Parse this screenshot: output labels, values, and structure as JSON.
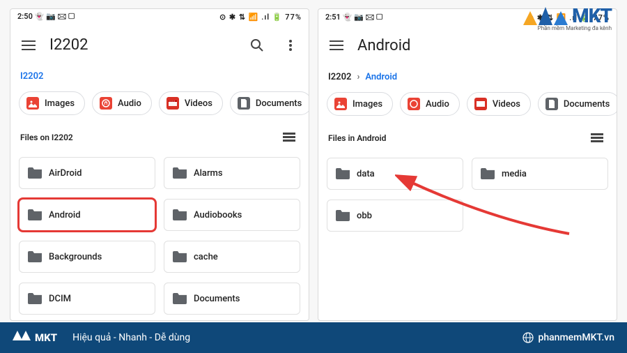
{
  "left": {
    "status_time": "2:50",
    "status_left_icons": "👻 📷 🖂 ▢",
    "status_right": "⊙ ✱ ⇅ 📶 .ıl 🔋 77%",
    "title": "I2202",
    "breadcrumb_root": "I2202",
    "section_label": "Files on I2202",
    "folders": [
      "AirDroid",
      "Alarms",
      "Android",
      "Audiobooks",
      "Backgrounds",
      "cache",
      "DCIM",
      "Documents"
    ]
  },
  "right": {
    "status_time": "2:51",
    "status_left_icons": "👻 📷 🖂 ▢",
    "status_right": "⊙ ✱ ⇅ 📶 .ıl 🔋 77%",
    "title": "Android",
    "crumb1": "I2202",
    "crumb2": "Android",
    "section_label": "Files in Android",
    "folders": [
      "data",
      "media",
      "obb"
    ]
  },
  "chips": {
    "images": "Images",
    "audio": "Audio",
    "videos": "Videos",
    "documents": "Documents"
  },
  "brand": {
    "name": "MKT",
    "sub": "Phần mềm Marketing đa kênh",
    "footer_small": "MKT",
    "footer_text": "Hiệu quả - Nhanh - Dễ dùng",
    "footer_site": "phanmemMKT.vn"
  }
}
